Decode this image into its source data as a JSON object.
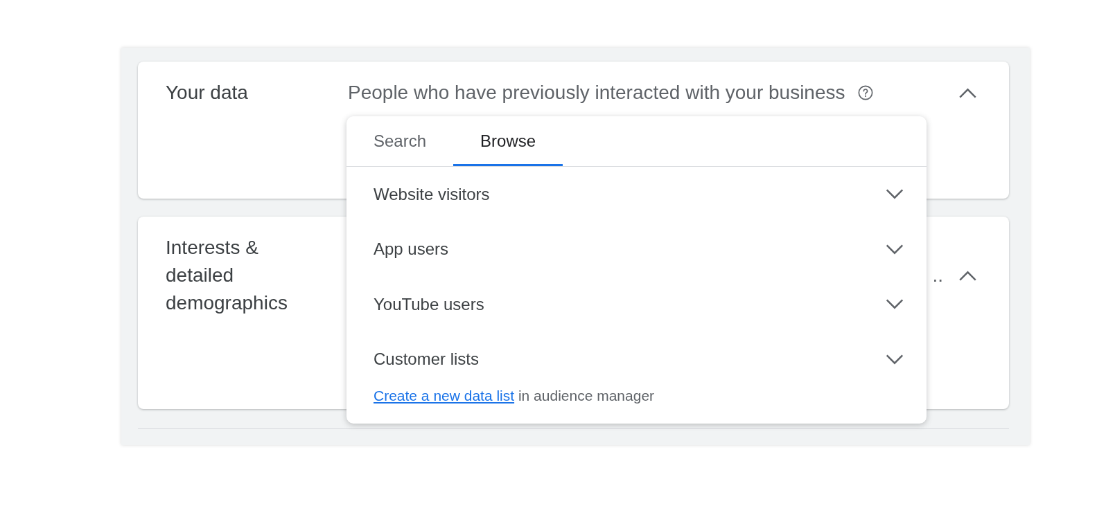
{
  "sections": [
    {
      "title": "Your data",
      "description": "People who have previously interacted with your business",
      "help": true,
      "expanded": true
    },
    {
      "title": "Interests & detailed demographics",
      "description": "..",
      "expanded": true
    }
  ],
  "dropdown": {
    "tabs": [
      {
        "label": "Search",
        "selected": false
      },
      {
        "label": "Browse",
        "selected": true
      }
    ],
    "items": [
      {
        "label": "Website visitors",
        "expanded": false
      },
      {
        "label": "App users",
        "expanded": false
      },
      {
        "label": "YouTube users",
        "expanded": false
      },
      {
        "label": "Customer lists",
        "expanded": false
      }
    ],
    "footer": {
      "link": "Create a new data list",
      "text": "in audience manager"
    }
  }
}
